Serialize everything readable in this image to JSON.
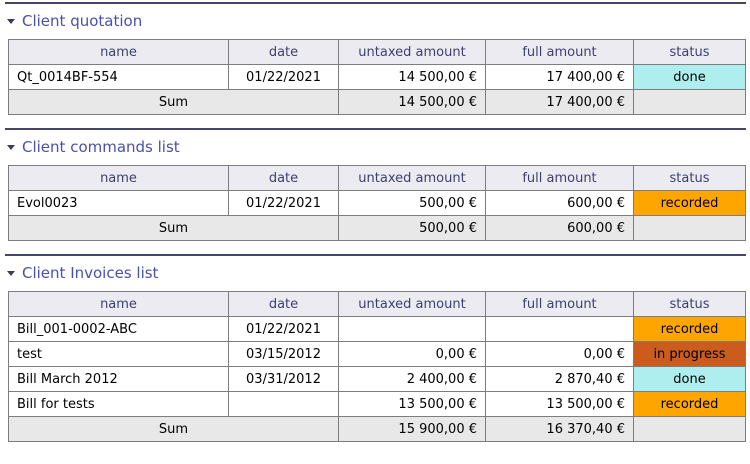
{
  "colors": {
    "section_rule": "#454568",
    "section_title_text": "#4a4fae",
    "table_border": "#7d7d7d",
    "header_bg": "#ebebf1",
    "header_text": "#3f3f6e",
    "sum_row_bg": "#e8e8e8",
    "row_bg": "#ffffff",
    "status_done_bg": "#aeeeee",
    "status_recorded_bg": "#ffa500",
    "status_in_progress_bg": "#cb5c1e"
  },
  "columns": [
    {
      "key": "name",
      "label": "name"
    },
    {
      "key": "date",
      "label": "date"
    },
    {
      "key": "untaxed",
      "label": "untaxed amount"
    },
    {
      "key": "full",
      "label": "full amount"
    },
    {
      "key": "status",
      "label": "status"
    }
  ],
  "status_styles": {
    "done": "#aeeeee",
    "recorded": "#ffa500",
    "in progress": "#cb5c1e"
  },
  "sections": [
    {
      "id": "client-quotation",
      "title": "Client quotation",
      "collapse_icon": "triangle-down",
      "rows": [
        {
          "name": "Qt_0014BF-554",
          "date": "01/22/2021",
          "untaxed": "14 500,00 €",
          "full": "17 400,00 €",
          "status": "done"
        }
      ],
      "sum": {
        "label": "Sum",
        "untaxed": "14 500,00 €",
        "full": "17 400,00 €"
      }
    },
    {
      "id": "client-commands-list",
      "title": "Client commands list",
      "collapse_icon": "triangle-down",
      "rows": [
        {
          "name": "Evol0023",
          "date": "01/22/2021",
          "untaxed": "500,00 €",
          "full": "600,00 €",
          "status": "recorded"
        }
      ],
      "sum": {
        "label": "Sum",
        "untaxed": "500,00 €",
        "full": "600,00 €"
      }
    },
    {
      "id": "client-invoices-list",
      "title": "Client Invoices list",
      "collapse_icon": "triangle-down",
      "rows": [
        {
          "name": "Bill_001-0002-ABC",
          "date": "01/22/2021",
          "untaxed": "",
          "full": "",
          "status": "recorded"
        },
        {
          "name": "test",
          "date": "03/15/2012",
          "untaxed": "0,00 €",
          "full": "0,00 €",
          "status": "in progress"
        },
        {
          "name": "Bill March 2012",
          "date": "03/31/2012",
          "untaxed": "2 400,00 €",
          "full": "2 870,40 €",
          "status": "done"
        },
        {
          "name": "Bill for tests",
          "date": "",
          "untaxed": "13 500,00 €",
          "full": "13 500,00 €",
          "status": "recorded"
        }
      ],
      "sum": {
        "label": "Sum",
        "untaxed": "15 900,00 €",
        "full": "16 370,40 €"
      }
    }
  ]
}
